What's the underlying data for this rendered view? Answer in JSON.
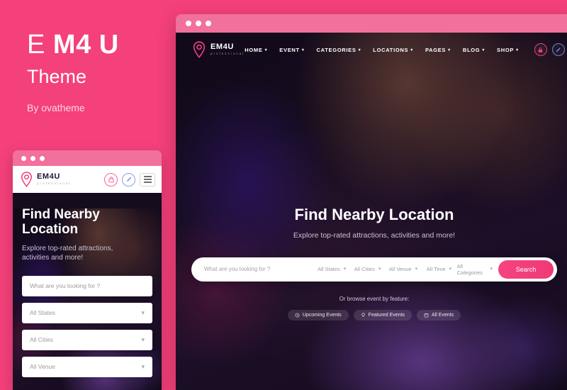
{
  "promo": {
    "title_part1": "E",
    "title_part2": "M4 U",
    "subtitle": "Theme",
    "byline": "By ovatheme",
    "brand_pink": "#f4407b"
  },
  "window_controls": {
    "dot1": "close-dot",
    "dot2": "minimize-dot",
    "dot3": "maximize-dot"
  },
  "site": {
    "logo": {
      "name": "EM4U",
      "tagline": "professional"
    },
    "nav": [
      {
        "label": "HOME",
        "has_dropdown": true
      },
      {
        "label": "EVENT",
        "has_dropdown": true
      },
      {
        "label": "CATEGORIES",
        "has_dropdown": true
      },
      {
        "label": "LOCATIONS",
        "has_dropdown": true
      },
      {
        "label": "PAGES",
        "has_dropdown": true
      },
      {
        "label": "BLOG",
        "has_dropdown": true
      },
      {
        "label": "SHOP",
        "has_dropdown": true
      }
    ],
    "nav_dropdown_arrow": "▾",
    "actions": [
      {
        "name": "lock-icon",
        "color": "#ef3e7c"
      },
      {
        "name": "pen-icon",
        "color": "#6e7fe0"
      }
    ],
    "hero": {
      "heading": "Find Nearby Location",
      "heading_line1": "Find Nearby",
      "heading_line2": "Location",
      "subheading": "Explore top-rated attractions, activities and more!",
      "subheading_line1": "Explore top-rated attractions,",
      "subheading_line2": "activities and more!"
    },
    "search": {
      "keyword_placeholder": "What are you looking for ?",
      "filters": [
        {
          "label": "All States"
        },
        {
          "label": "All Cities"
        },
        {
          "label": "All Venue"
        },
        {
          "label": "All Time"
        },
        {
          "label": "All Categories"
        }
      ],
      "button_label": "Search",
      "caret": "▾"
    },
    "browse": {
      "label": "Or browse event by feature:",
      "pills": [
        {
          "label": "Upcoming Events",
          "icon": "clock-icon"
        },
        {
          "label": "Featured Events",
          "icon": "lightbulb-icon"
        },
        {
          "label": "All Events",
          "icon": "calendar-icon"
        }
      ]
    }
  }
}
